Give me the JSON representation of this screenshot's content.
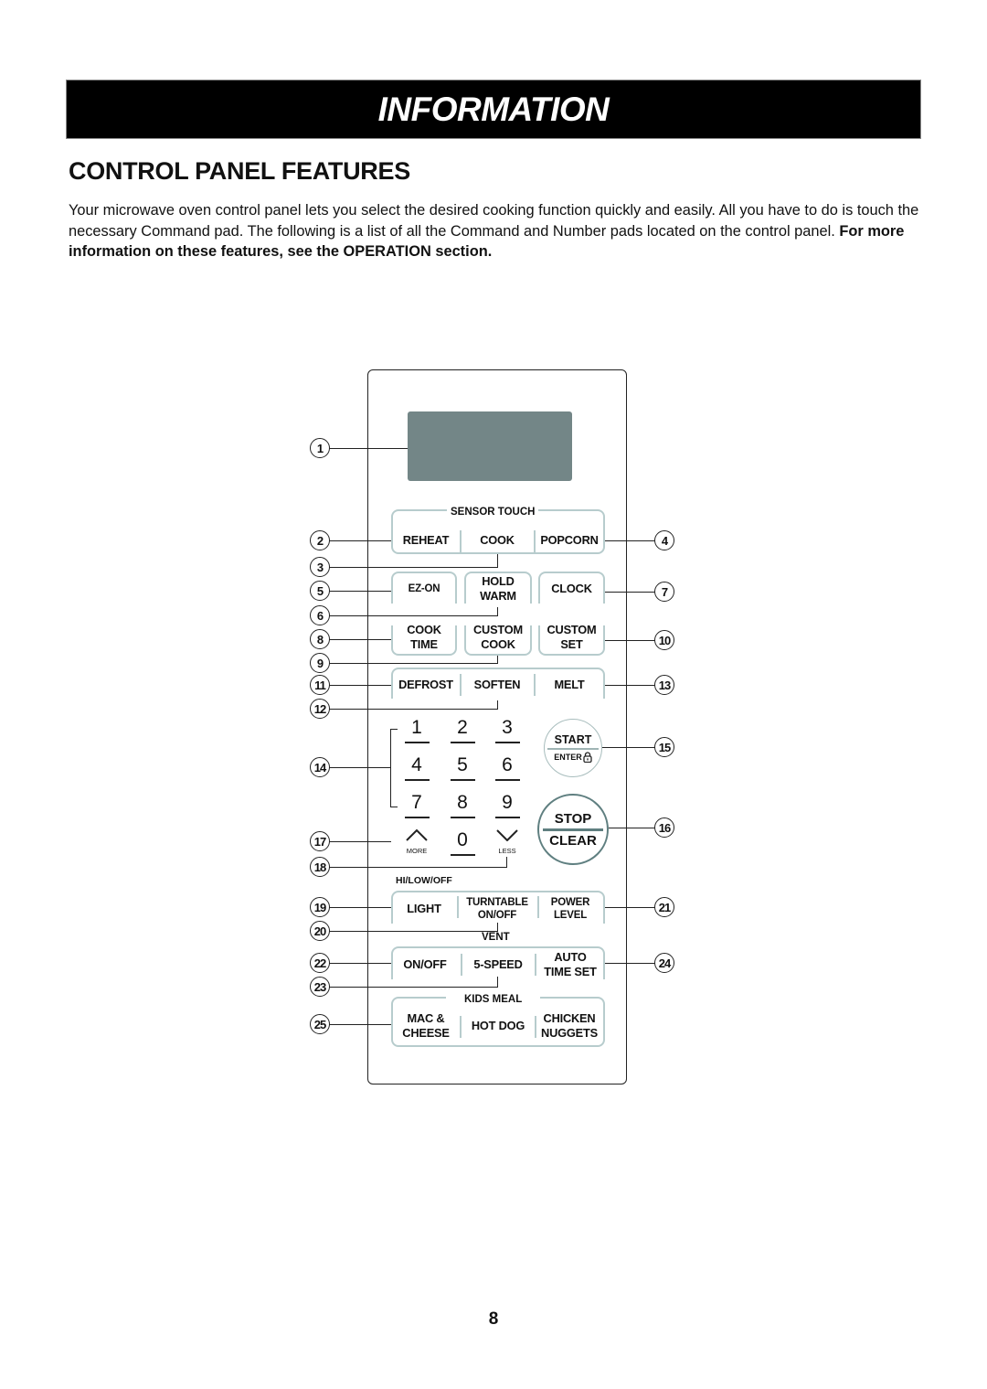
{
  "banner": {
    "title": "INFORMATION"
  },
  "section": {
    "title": "CONTROL PANEL FEATURES"
  },
  "intro": {
    "text": "Your microwave oven control panel lets you select the desired cooking function quickly and easily. All you have to do is touch the necessary Command pad. The following is a list of all the Command and Number pads located on the control panel. ",
    "bold": "For more information on these features, see the OPERATION section."
  },
  "panel": {
    "colors": {
      "display": "#738687",
      "outline": "#b7cccd",
      "stop_ring": "#5f7f80"
    },
    "group_labels": {
      "sensor_touch": "SENSOR TOUCH",
      "hi_low_off": "HI/LOW/OFF",
      "vent": "VENT",
      "kids_meal": "KIDS MEAL"
    },
    "pads": {
      "reheat": "REHEAT",
      "cook": "COOK",
      "popcorn": "POPCORN",
      "ez_on": "EZ-ON",
      "hold_warm": "HOLD\nWARM",
      "clock": "CLOCK",
      "cook_time": "COOK\nTIME",
      "custom_cook": "CUSTOM\nCOOK",
      "custom_set": "CUSTOM\nSET",
      "defrost": "DEFROST",
      "soften": "SOFTEN",
      "melt": "MELT",
      "light": "LIGHT",
      "turntable": "TURNTABLE\nON/OFF",
      "power_level": "POWER\nLEVEL",
      "vent_onoff": "ON/OFF",
      "five_speed": "5-SPEED",
      "auto_time_set": "AUTO\nTIME SET",
      "mac_cheese": "MAC &\nCHEESE",
      "hot_dog": "HOT DOG",
      "chicken_nuggets": "CHICKEN\nNUGGETS"
    },
    "number_pads": [
      "1",
      "2",
      "3",
      "4",
      "5",
      "6",
      "7",
      "8",
      "9",
      "0"
    ],
    "more": {
      "label": "MORE",
      "icon": "chevron-up-icon"
    },
    "less": {
      "label": "LESS",
      "icon": "chevron-down-icon"
    },
    "start": {
      "top": "START",
      "bottom": "ENTER",
      "icon": "lock-icon"
    },
    "stop": {
      "top": "STOP",
      "bottom": "CLEAR"
    },
    "callouts": [
      "1",
      "2",
      "3",
      "4",
      "5",
      "6",
      "7",
      "8",
      "9",
      "10",
      "11",
      "12",
      "13",
      "14",
      "15",
      "16",
      "17",
      "18",
      "19",
      "20",
      "21",
      "22",
      "23",
      "24",
      "25"
    ]
  },
  "page": {
    "number": "8"
  }
}
